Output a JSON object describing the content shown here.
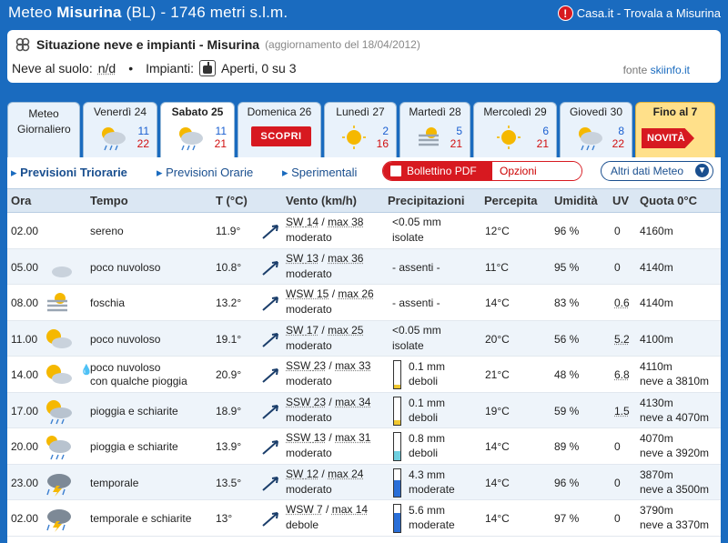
{
  "header": {
    "prefix": "Meteo",
    "place": "Misurina",
    "rest": " (BL) - 1746 metri s.l.m.",
    "casa_icon": "info-icon",
    "casa_text": "Casa.it - Trovala a Misurina"
  },
  "snow": {
    "title": "Situazione neve e impianti - Misurina",
    "update": "(aggiornamento del 18/04/2012)",
    "snow_label": "Neve al suolo:",
    "snow_value": "n/d",
    "bullet": "•",
    "lifts_label": "Impianti:",
    "lifts_value": "Aperti, 0 su 3",
    "source_label": "fonte",
    "source_name": "skiinfo.it"
  },
  "tabs": [
    {
      "name": "Meteo Giornaliero"
    },
    {
      "name": "Venerdì 24",
      "max": "11",
      "min": "22",
      "icon": "cloud-rain-sun-icon"
    },
    {
      "name": "Sabato 25",
      "max": "11",
      "min": "21",
      "icon": "cloud-rain-sun-icon"
    },
    {
      "name": "Domenica 26",
      "badge": "SCOPRI"
    },
    {
      "name": "Lunedì 27",
      "max": "2",
      "min": "16",
      "icon": "sun-icon"
    },
    {
      "name": "Martedì 28",
      "max": "5",
      "min": "21",
      "icon": "fog-icon"
    },
    {
      "name": "Mercoledì 29",
      "max": "6",
      "min": "21",
      "icon": "sun-icon"
    },
    {
      "name": "Giovedì 30",
      "max": "8",
      "min": "22",
      "icon": "cloud-rain-sun-icon"
    },
    {
      "name": "Fino al 7",
      "badge": "NOVITÀ"
    }
  ],
  "subnav": {
    "link1": "Previsioni Triorarie",
    "link2": "Previsioni Orarie",
    "link3": "Sperimentali",
    "pdf": "Bollettino PDF",
    "options": "Opzioni",
    "more": "Altri dati Meteo"
  },
  "columns": {
    "ora": "Ora",
    "tempo": "Tempo",
    "temp": "T (°C)",
    "vento": "Vento (km/h)",
    "precip": "Precipitazioni",
    "perc": "Percepita",
    "umid": "Umidità",
    "uv": "UV",
    "quota": "Quota 0°C"
  },
  "rows": [
    {
      "ora": "02.00",
      "icon": "moon-icon",
      "tempo": "sereno",
      "t": "11.9°",
      "dir": "SW",
      "ws": "14",
      "max": "max 38",
      "wdesc": "moderato",
      "p1": "<0.05 mm",
      "p2": "isolate",
      "pfill": 0,
      "perc": "12°C",
      "umid": "96 %",
      "uv": "0",
      "q1": "4160m",
      "q2": ""
    },
    {
      "ora": "05.00",
      "icon": "moon-cloud-icon",
      "tempo": "poco nuvoloso",
      "t": "10.8°",
      "dir": "SW",
      "ws": "13",
      "max": "max 36",
      "wdesc": "moderato",
      "p1": "- assenti -",
      "p2": "",
      "pfill": 0,
      "perc": "11°C",
      "umid": "95 %",
      "uv": "0",
      "q1": "4140m",
      "q2": ""
    },
    {
      "ora": "08.00",
      "icon": "fog-icon",
      "tempo": "foschia",
      "t": "13.2°",
      "dir": "WSW",
      "ws": "15",
      "max": "max 26",
      "wdesc": "moderato",
      "p1": "- assenti -",
      "p2": "",
      "pfill": 0,
      "perc": "14°C",
      "umid": "83 %",
      "uv": "0.6",
      "q1": "4140m",
      "q2": ""
    },
    {
      "ora": "11.00",
      "icon": "sun-cloud-icon",
      "tempo": "poco nuvoloso",
      "t": "19.1°",
      "dir": "SW",
      "ws": "17",
      "max": "max 25",
      "wdesc": "moderato",
      "p1": "<0.05 mm",
      "p2": "isolate",
      "pfill": 0,
      "perc": "20°C",
      "umid": "56 %",
      "uv": "5.2",
      "q1": "4100m",
      "q2": ""
    },
    {
      "ora": "14.00",
      "icon": "sun-cloud-icon",
      "tempo": "poco nuvoloso",
      "tempo2": "con qualche pioggia",
      "rain": true,
      "t": "20.9°",
      "dir": "SSW",
      "ws": "23",
      "max": "max 33",
      "wdesc": "moderato",
      "p1": "0.1 mm",
      "p2": "deboli",
      "pfill": 0.15,
      "pcolor": "#f0c830",
      "perc": "21°C",
      "umid": "48 %",
      "uv": "6.8",
      "q1": "4110m",
      "q2": "neve a 3810m"
    },
    {
      "ora": "17.00",
      "icon": "sun-rain-icon",
      "tempo": "pioggia e schiarite",
      "t": "18.9°",
      "dir": "SSW",
      "ws": "23",
      "max": "max 34",
      "wdesc": "moderato",
      "p1": "0.1 mm",
      "p2": "deboli",
      "pfill": 0.15,
      "pcolor": "#f0c830",
      "perc": "19°C",
      "umid": "59 %",
      "uv": "1.5",
      "q1": "4130m",
      "q2": "neve a 4070m"
    },
    {
      "ora": "20.00",
      "icon": "cloud-rain-icon",
      "tempo": "pioggia e schiarite",
      "t": "13.9°",
      "dir": "SSW",
      "ws": "13",
      "max": "max 31",
      "wdesc": "moderato",
      "p1": "0.8 mm",
      "p2": "deboli",
      "pfill": 0.35,
      "pcolor": "#6fd0e0",
      "perc": "14°C",
      "umid": "89 %",
      "uv": "0",
      "q1": "4070m",
      "q2": "neve a 3920m"
    },
    {
      "ora": "23.00",
      "icon": "thunderstorm-icon",
      "tempo": "temporale",
      "t": "13.5°",
      "dir": "SW",
      "ws": "12",
      "max": "max 24",
      "wdesc": "moderato",
      "p1": "4.3 mm",
      "p2": "moderate",
      "pfill": 0.6,
      "pcolor": "#2a6fd8",
      "perc": "14°C",
      "umid": "96 %",
      "uv": "0",
      "q1": "3870m",
      "q2": "neve a 3500m"
    },
    {
      "ora": "02.00",
      "icon": "thunderstorm-icon",
      "tempo": "temporale e schiarite",
      "t": "13°",
      "dir": "WSW",
      "ws": "7",
      "max": "max 14",
      "wdesc": "debole",
      "p1": "5.6 mm",
      "p2": "moderate",
      "pfill": 0.7,
      "pcolor": "#2a6fd8",
      "perc": "14°C",
      "umid": "97 %",
      "uv": "0",
      "q1": "3790m",
      "q2": "neve a 3370m"
    }
  ]
}
